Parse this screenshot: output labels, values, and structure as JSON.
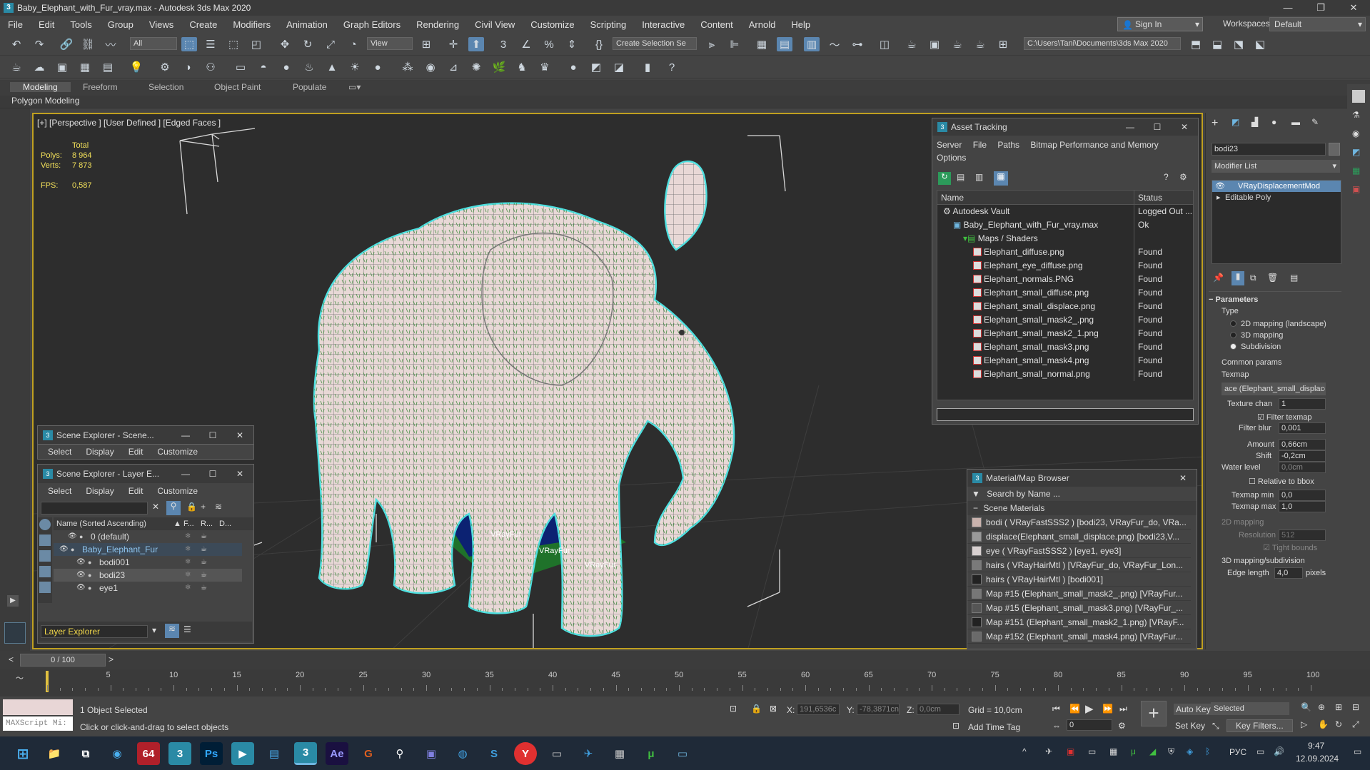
{
  "window": {
    "title": "Baby_Elephant_with_Fur_vray.max - Autodesk 3ds Max 2020"
  },
  "menu": [
    "File",
    "Edit",
    "Tools",
    "Group",
    "Views",
    "Create",
    "Modifiers",
    "Animation",
    "Graph Editors",
    "Rendering",
    "Civil View",
    "Customize",
    "Scripting",
    "Interactive",
    "Content",
    "Arnold",
    "Help"
  ],
  "account": {
    "signin": "Sign In",
    "workspaces_label": "Workspaces:",
    "workspace": "Default"
  },
  "toolbar": {
    "filter": "All",
    "refcoord": "View",
    "selection_set": "Create Selection Se",
    "path": "C:\\Users\\Tani\\Documents\\3ds Max 2020"
  },
  "ribbon": {
    "tabs": [
      "Modeling",
      "Freeform",
      "Selection",
      "Object Paint",
      "Populate"
    ],
    "panel": "Polygon Modeling"
  },
  "viewport": {
    "label": "[+] [Perspective ] [User Defined ] [Edged Faces ]",
    "stats": {
      "total": "Total",
      "polys_label": "Polys:",
      "polys": "8 964",
      "verts_label": "Verts:",
      "verts": "7 873",
      "fps_label": "FPS:",
      "fps": "0,587"
    },
    "gizmo_labels": [
      "VRayFur",
      "VRayFur",
      "VRayFur"
    ]
  },
  "asset_tracking": {
    "title": "Asset Tracking",
    "menu": [
      "Server",
      "File",
      "Paths",
      "Bitmap Performance and Memory"
    ],
    "menu2": "Options",
    "col_name": "Name",
    "col_status": "Status",
    "rows": [
      {
        "name": "Autodesk Vault",
        "status": "Logged Out ...",
        "level": 0
      },
      {
        "name": "Baby_Elephant_with_Fur_vray.max",
        "status": "Ok",
        "level": 1
      },
      {
        "name": "Maps / Shaders",
        "status": "",
        "level": 2
      },
      {
        "name": "Elephant_diffuse.png",
        "status": "Found",
        "level": 3
      },
      {
        "name": "Elephant_eye_diffuse.png",
        "status": "Found",
        "level": 3
      },
      {
        "name": "Elephant_normals.PNG",
        "status": "Found",
        "level": 3
      },
      {
        "name": "Elephant_small_diffuse.png",
        "status": "Found",
        "level": 3
      },
      {
        "name": "Elephant_small_displace.png",
        "status": "Found",
        "level": 3
      },
      {
        "name": "Elephant_small_mask2_.png",
        "status": "Found",
        "level": 3
      },
      {
        "name": "Elephant_small_mask2_1.png",
        "status": "Found",
        "level": 3
      },
      {
        "name": "Elephant_small_mask3.png",
        "status": "Found",
        "level": 3
      },
      {
        "name": "Elephant_small_mask4.png",
        "status": "Found",
        "level": 3
      },
      {
        "name": "Elephant_small_normal.png",
        "status": "Found",
        "level": 3
      }
    ]
  },
  "material_browser": {
    "title": "Material/Map Browser",
    "search": "Search by Name ...",
    "section": "Scene Materials",
    "items": [
      "bodi ( VRayFastSSS2 ) [bodi23, VRayFur_do, VRa...",
      "displace(Elephant_small_displace.png) [bodi23,V...",
      "eye ( VRayFastSSS2 ) [eye1, eye3]",
      "hairs ( VRayHairMtl ) [VRayFur_do, VRayFur_Lon...",
      "hairs ( VRayHairMtl ) [bodi001]",
      "Map #15 (Elephant_small_mask2_.png) [VRayFur...",
      "Map #15 (Elephant_small_mask3.png) [VRayFur_...",
      "Map #151 (Elephant_small_mask2_1.png) [VRayF...",
      "Map #152 (Elephant_small_mask4.png) [VRayFur..."
    ],
    "swatch_colors": [
      "#c9b2ad",
      "#999999",
      "#d8d0d0",
      "#7a7a7a",
      "#222222",
      "#777777",
      "#555555",
      "#222222",
      "#6a6a6a"
    ]
  },
  "scene_explorer": {
    "title1": "Scene Explorer - Scene...",
    "title2": "Scene Explorer - Layer E...",
    "menu": [
      "Select",
      "Display",
      "Edit",
      "Customize"
    ],
    "col_name": "Name (Sorted Ascending)",
    "col_f": "F...",
    "col_r": "R...",
    "col_d": "D...",
    "rows": [
      {
        "name": "0 (default)",
        "indent": 1
      },
      {
        "name": "Baby_Elephant_Fur",
        "indent": 0
      },
      {
        "name": "bodi001",
        "indent": 2
      },
      {
        "name": "bodi23",
        "indent": 2
      },
      {
        "name": "eye1",
        "indent": 2
      }
    ],
    "layer_explorer": "Layer Explorer"
  },
  "command_panel": {
    "object_name": "bodi23",
    "modifier_list": "Modifier List",
    "stack": [
      "VRayDisplacementMod",
      "Editable Poly"
    ],
    "params_title": "Parameters",
    "type_label": "Type",
    "types": [
      "2D mapping (landscape)",
      "3D mapping",
      "Subdivision"
    ],
    "common_params": "Common params",
    "texmap_label": "Texmap",
    "texmap": "ace (Elephant_small_displace.",
    "texture_chan_label": "Texture chan",
    "texture_chan": "1",
    "filter_texmap": "Filter texmap",
    "filter_blur_label": "Filter blur",
    "filter_blur": "0,001",
    "amount_label": "Amount",
    "amount": "0,66cm",
    "shift_label": "Shift",
    "shift": "-0,2cm",
    "water_level_label": "Water level",
    "water_level": "0,0cm",
    "relative_bbox": "Relative to bbox",
    "texmap_min_label": "Texmap min",
    "texmap_min": "0,0",
    "texmap_max_label": "Texmap max",
    "texmap_max": "1,0",
    "mapping_2d": "2D mapping",
    "resolution_label": "Resolution",
    "resolution": "512",
    "tight_bounds": "Tight bounds",
    "mapping_3d": "3D mapping/subdivision",
    "edge_length_label": "Edge length",
    "edge_length": "4,0",
    "edge_unit": "pixels"
  },
  "timeline": {
    "frame": "0 / 100",
    "ticks": [
      0,
      5,
      10,
      15,
      20,
      25,
      30,
      35,
      40,
      45,
      50,
      55,
      60,
      65,
      70,
      75,
      80,
      85,
      90,
      95,
      100
    ]
  },
  "status": {
    "maxscript": "MAXScript Mi:",
    "selected": "1 Object Selected",
    "hint": "Click or click-and-drag to select objects",
    "x_label": "X:",
    "x": "191,6536c",
    "y_label": "Y:",
    "y": "-78,3871cn",
    "z_label": "Z:",
    "z": "0,0cm",
    "grid": "Grid = 10,0cm",
    "add_time_tag": "Add Time Tag",
    "auto_key": "Auto Key",
    "set_key": "Set Key",
    "key_mode": "Selected",
    "key_filters": "Key Filters...",
    "frame_field": "0"
  },
  "taskbar": {
    "lang": "РУС",
    "time": "9:47",
    "date": "12.09.2024"
  }
}
